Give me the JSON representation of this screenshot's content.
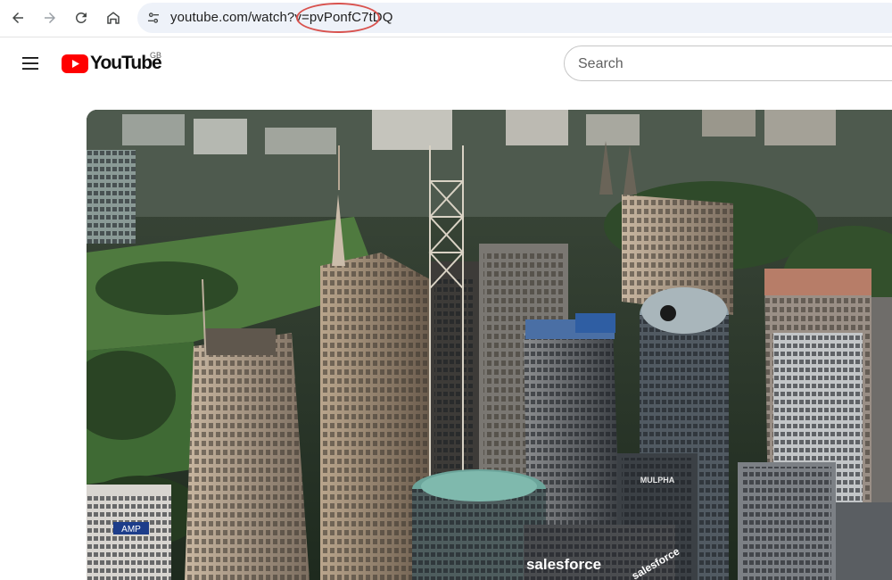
{
  "browser": {
    "url_base": "youtube.com/watch?v=",
    "url_video_id": "pvPonfC7tDQ",
    "annotation_color": "#d9534f"
  },
  "header": {
    "logo_text": "YouTube",
    "country_code": "GB",
    "search_placeholder": "Search",
    "brand_color": "#ff0000"
  },
  "player": {
    "billboard_salesforce": "salesforce",
    "billboard_mulpha": "MULPHA",
    "billboard_salesforce_2": "salesforce",
    "billboard_amp": "AMP"
  },
  "icons": {
    "back": "arrow-left-icon",
    "forward": "arrow-right-icon",
    "reload": "reload-icon",
    "home": "home-icon",
    "site_info": "tune-icon",
    "menu": "hamburger-icon"
  }
}
